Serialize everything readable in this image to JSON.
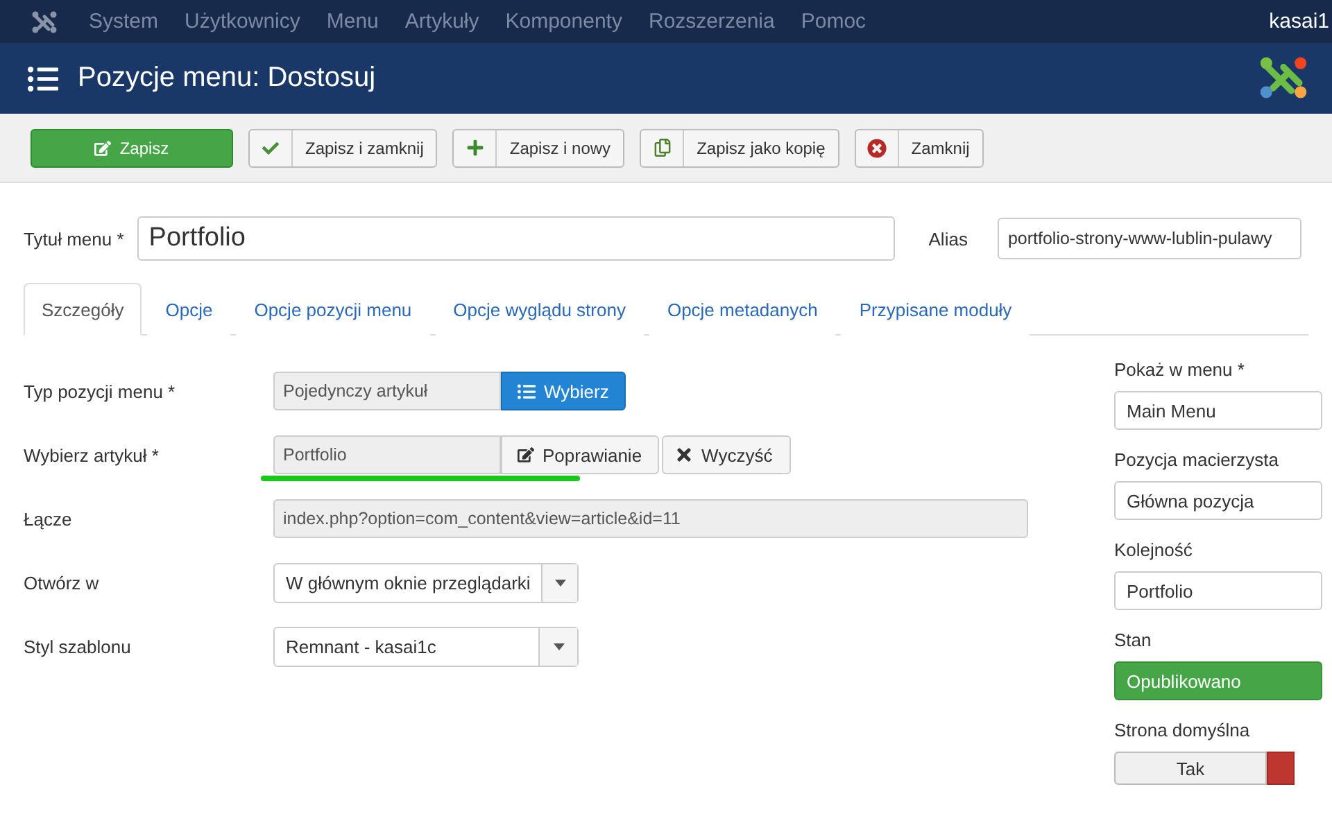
{
  "top_menu": {
    "items": [
      "System",
      "Użytkownicy",
      "Menu",
      "Artykuły",
      "Komponenty",
      "Rozszerzenia",
      "Pomoc"
    ],
    "user": "kasai1"
  },
  "header": {
    "title": "Pozycje menu: Dostosuj"
  },
  "toolbar": [
    {
      "label": "Zapisz",
      "kind": "primary"
    },
    {
      "label": "Zapisz i zamknij",
      "kind": "default"
    },
    {
      "label": "Zapisz i nowy",
      "kind": "default"
    },
    {
      "label": "Zapisz jako kopię",
      "kind": "default"
    },
    {
      "label": "Zamknij",
      "kind": "default"
    }
  ],
  "title_field": {
    "label": "Tytuł menu *",
    "value": "Portfolio"
  },
  "alias_field": {
    "label": "Alias",
    "value": "portfolio-strony-www-lublin-pulawy"
  },
  "tabs": [
    {
      "label": "Szczegóły",
      "selected": true
    },
    {
      "label": "Opcje",
      "selected": false
    },
    {
      "label": "Opcje pozycji menu",
      "selected": false
    },
    {
      "label": "Opcje wyglądu strony",
      "selected": false
    },
    {
      "label": "Opcje metadanych",
      "selected": false
    },
    {
      "label": "Przypisane moduły",
      "selected": false
    }
  ],
  "form": [
    {
      "kind": "picker",
      "label": "Typ pozycji menu *",
      "value": "Pojedynczy artykuł",
      "buttons": [
        {
          "label": "Wybierz",
          "kind": "primary"
        }
      ]
    },
    {
      "kind": "picker",
      "label": "Wybierz artykuł *",
      "value": "Portfolio",
      "highlighted": true,
      "buttons": [
        {
          "label": "Poprawianie",
          "kind": "default"
        },
        {
          "label": "Wyczyść",
          "kind": "default"
        }
      ]
    },
    {
      "kind": "readonly",
      "label": "Łącze",
      "value": "index.php?option=com_content&view=article&id=11"
    },
    {
      "kind": "select",
      "label": "Otwórz w",
      "value": "W głównym oknie przeglądarki"
    },
    {
      "kind": "select",
      "label": "Styl szablonu",
      "value": "Remnant - kasai1c"
    }
  ],
  "sidebar": [
    {
      "kind": "select",
      "label": "Pokaż w menu *",
      "value": "Main Menu"
    },
    {
      "kind": "select",
      "label": "Pozycja macierzysta",
      "value": "Główna pozycja"
    },
    {
      "kind": "select",
      "label": "Kolejność",
      "value": "Portfolio"
    },
    {
      "kind": "status",
      "label": "Stan",
      "value": "Opublikowano"
    },
    {
      "kind": "toggle",
      "label": "Strona domyślna",
      "options": [
        {
          "label": "Tak",
          "selected": false
        }
      ],
      "other_selected": true
    }
  ]
}
